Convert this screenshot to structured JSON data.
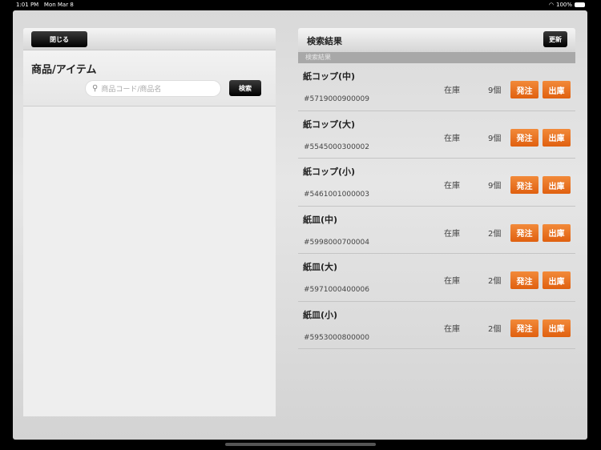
{
  "status": {
    "time": "1:01 PM",
    "date": "Mon Mar 8",
    "battery": "100%"
  },
  "left": {
    "close_label": "閉じる",
    "title": "商品/アイテム",
    "search_placeholder": "商品コード/商品名",
    "search_button": "検索"
  },
  "right": {
    "title": "検索結果",
    "refresh_label": "更新",
    "section": "検索結果",
    "items": [
      {
        "name": "紙コップ(中)",
        "code": "#5719000900009",
        "stock_label": "在庫",
        "qty": "9個",
        "order": "発注",
        "ship": "出庫"
      },
      {
        "name": "紙コップ(大)",
        "code": "#5545000300002",
        "stock_label": "在庫",
        "qty": "9個",
        "order": "発注",
        "ship": "出庫"
      },
      {
        "name": "紙コップ(小)",
        "code": "#5461001000003",
        "stock_label": "在庫",
        "qty": "9個",
        "order": "発注",
        "ship": "出庫"
      },
      {
        "name": "紙皿(中)",
        "code": "#5998000700004",
        "stock_label": "在庫",
        "qty": "2個",
        "order": "発注",
        "ship": "出庫"
      },
      {
        "name": "紙皿(大)",
        "code": "#5971000400006",
        "stock_label": "在庫",
        "qty": "2個",
        "order": "発注",
        "ship": "出庫"
      },
      {
        "name": "紙皿(小)",
        "code": "#5953000800000",
        "stock_label": "在庫",
        "qty": "2個",
        "order": "発注",
        "ship": "出庫"
      }
    ]
  }
}
